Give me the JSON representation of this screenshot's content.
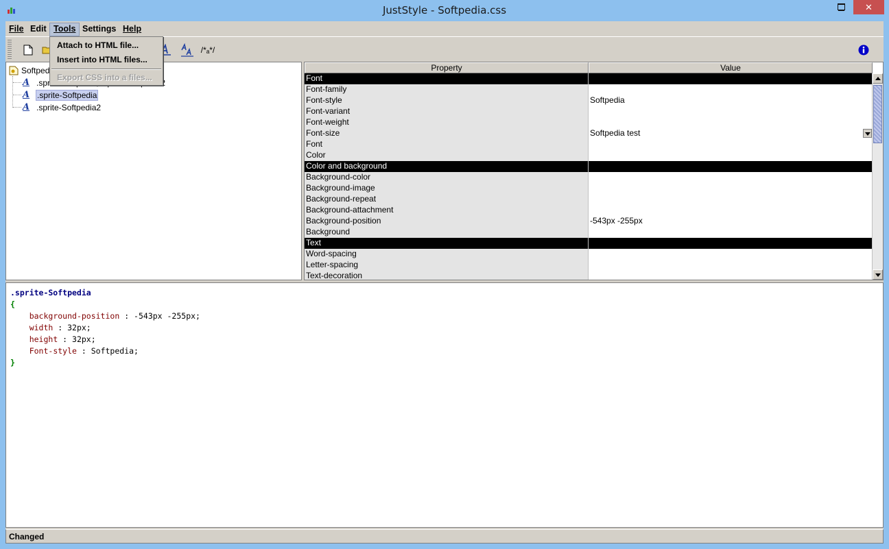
{
  "window": {
    "title": "JustStyle - Softpedia.css",
    "minimize_glyph": "",
    "maximize_glyph": "",
    "close_glyph": "✕"
  },
  "menu": {
    "file": "File",
    "edit": "Edit",
    "tools": "Tools",
    "settings": "Settings",
    "help": "Help"
  },
  "tools_menu": {
    "attach": "Attach to HTML file...",
    "insert": "Insert into HTML files...",
    "export": "Export CSS into a files..."
  },
  "toolbar": {
    "comment_glyph": "/*ₐ*/",
    "info_glyph": "i"
  },
  "tree": {
    "root": "Softpedia",
    "nodes": [
      ".sprite-Softpedia, .sprite-Softpedia2",
      ".sprite-Softpedia",
      ".sprite-Softpedia2"
    ],
    "node_glyph": "A",
    "selected_index": 1
  },
  "properties": {
    "header_property": "Property",
    "header_value": "Value",
    "rows": [
      {
        "p": "Font",
        "v": "",
        "section": true
      },
      {
        "p": "Font-family",
        "v": ""
      },
      {
        "p": "Font-style",
        "v": "Softpedia"
      },
      {
        "p": "Font-variant",
        "v": ""
      },
      {
        "p": "Font-weight",
        "v": ""
      },
      {
        "p": "Font-size",
        "v": "Softpedia test",
        "combo": true
      },
      {
        "p": "Font",
        "v": ""
      },
      {
        "p": "Color",
        "v": ""
      },
      {
        "p": "Color and background",
        "v": "",
        "section": true
      },
      {
        "p": "Background-color",
        "v": ""
      },
      {
        "p": "Background-image",
        "v": ""
      },
      {
        "p": "Background-repeat",
        "v": ""
      },
      {
        "p": "Background-attachment",
        "v": ""
      },
      {
        "p": "Background-position",
        "v": "-543px -255px"
      },
      {
        "p": "Background",
        "v": ""
      },
      {
        "p": "Text",
        "v": "",
        "section": true
      },
      {
        "p": "Word-spacing",
        "v": ""
      },
      {
        "p": "Letter-spacing",
        "v": ""
      },
      {
        "p": "Text-decoration",
        "v": ""
      }
    ]
  },
  "code": {
    "selector": ".sprite-Softpedia",
    "open_brace": "{",
    "close_brace": "}",
    "declarations": [
      {
        "prop": "background-position",
        "val": "-543px -255px;"
      },
      {
        "prop": "width",
        "val": "32px;"
      },
      {
        "prop": "height",
        "val": "32px;"
      },
      {
        "prop": "Font-style",
        "val": "Softpedia;"
      }
    ]
  },
  "status": {
    "text": "Changed"
  },
  "colors": {
    "title_bg": "#8dc0ee",
    "panel_bg": "#d4d0c8",
    "section_bg": "#000000",
    "selector": "#000080",
    "brace": "#008000",
    "css_property": "#800000",
    "info_icon": "#0000c8"
  }
}
